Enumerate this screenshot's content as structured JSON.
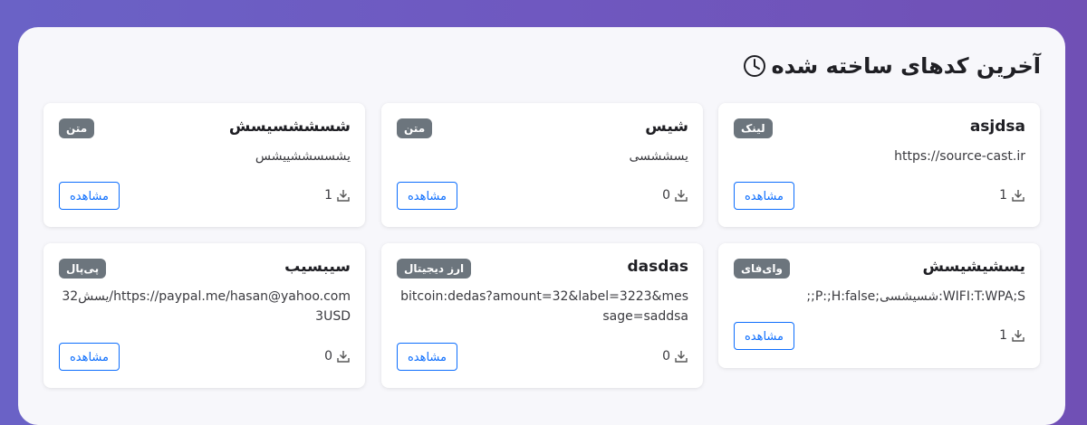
{
  "heading": {
    "title": "آخرین کدهای ساخته شده",
    "icon": "clock-icon"
  },
  "view_label": "مشاهده",
  "colors": {
    "accent": "#0d6efd",
    "badge": "#6c757d"
  },
  "cards": [
    {
      "name": "asjdsa",
      "badge": "لینک",
      "content": "https://source-cast.ir",
      "downloads": "1"
    },
    {
      "name": "شیس",
      "badge": "متن",
      "content": "یسششسی",
      "downloads": "0"
    },
    {
      "name": "شسششسیسش",
      "badge": "متن",
      "content": "یشسسششییشس",
      "downloads": "1"
    },
    {
      "name": "یسشیشیسش",
      "badge": "وای‌فای",
      "content": "WIFI:T:WPA;S:شسیشسی;P:;H:false;;",
      "downloads": "1"
    },
    {
      "name": "dasdas",
      "badge": "ارز دیجیتال",
      "content": "bitcoin:dedas?amount=32&label=3223&message=saddsa",
      "downloads": "0"
    },
    {
      "name": "سیبسیب",
      "badge": "پی‌پال",
      "content": "https://paypal.me/hasan@yahoo.com/یسش323USD",
      "downloads": "0"
    }
  ]
}
